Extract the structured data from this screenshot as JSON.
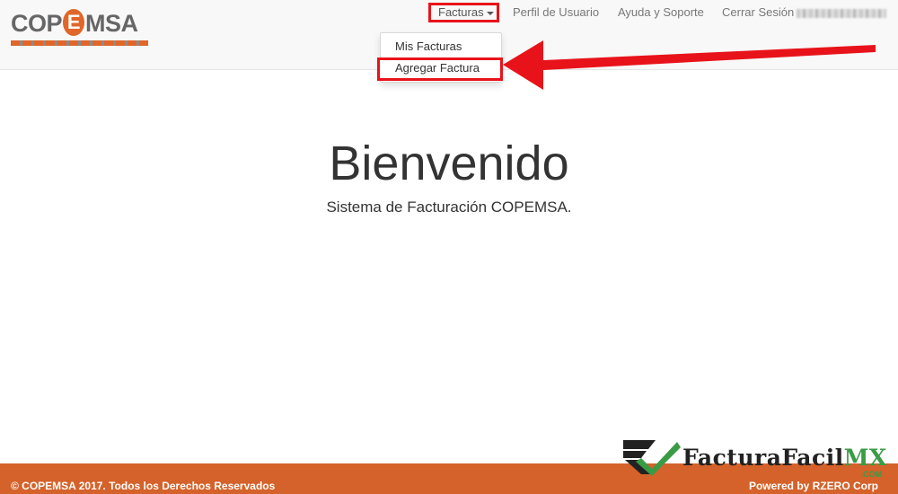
{
  "brand": {
    "logo_text_a": "COP",
    "logo_text_e": "E",
    "logo_text_b": "MSA",
    "accent": "#e0662a"
  },
  "nav": {
    "facturas": "Facturas",
    "perfil": "Perfil de Usuario",
    "ayuda": "Ayuda y Soporte",
    "cerrar": "Cerrar Sesión"
  },
  "dropdown": {
    "mis_facturas": "Mis Facturas",
    "agregar_factura": "Agregar Factura"
  },
  "main": {
    "title": "Bienvenido",
    "subtitle": "Sistema de Facturación COPEMSA."
  },
  "footer": {
    "copyright": "© COPEMSA 2017. Todos los Derechos Reservados",
    "powered": "Powered by RZERO Corp",
    "color": "#d4622a"
  },
  "watermark": {
    "text_a": "FacturaFacil",
    "text_b": "MX",
    "suffix": ".COM"
  },
  "annotation": {
    "highlight_color": "#e8131a"
  }
}
